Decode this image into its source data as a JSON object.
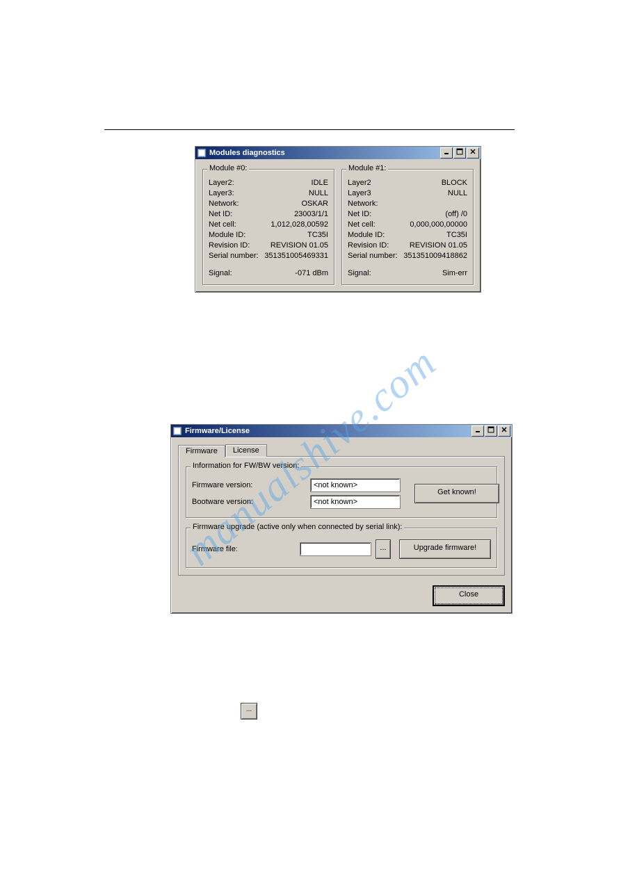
{
  "watermark": "manualshive.com",
  "diag_window": {
    "title": "Modules diagnostics",
    "module0": {
      "legend": "Module #0:",
      "rows": [
        {
          "k": "Layer2:",
          "v": "IDLE"
        },
        {
          "k": "Layer3:",
          "v": "NULL"
        },
        {
          "k": "Network:",
          "v": "OSKAR"
        },
        {
          "k": "Net ID:",
          "v": "23003/1/1"
        },
        {
          "k": "Net cell:",
          "v": "1,012,028,00592"
        },
        {
          "k": "Module ID:",
          "v": "TC35I"
        },
        {
          "k": "Revision ID:",
          "v": "REVISION 01.05"
        },
        {
          "k": "Serial number:",
          "v": "351351005469331"
        }
      ],
      "signal_k": "Signal:",
      "signal_v": "-071 dBm"
    },
    "module1": {
      "legend": "Module #1:",
      "rows": [
        {
          "k": "Layer2",
          "v": "BLOCK"
        },
        {
          "k": "Layer3",
          "v": "NULL"
        },
        {
          "k": "Network:",
          "v": ""
        },
        {
          "k": "Net ID:",
          "v": "(off)  /0"
        },
        {
          "k": "Net cell:",
          "v": "0,000,000,00000"
        },
        {
          "k": "Module ID:",
          "v": "TC35I"
        },
        {
          "k": "Revision ID:",
          "v": "REVISION 01.05"
        },
        {
          "k": "Serial number:",
          "v": "351351009418862"
        }
      ],
      "signal_k": "Signal:",
      "signal_v": "Sim-err"
    }
  },
  "fw_window": {
    "title": "Firmware/License",
    "tabs": {
      "firmware": "Firmware",
      "license": "License"
    },
    "info_group": {
      "legend": "Information for FW/BW version:",
      "fw_label": "Firmware version:",
      "fw_value": "<not known>",
      "bw_label": "Bootware version:",
      "bw_value": "<not known>",
      "btn": "Get known!"
    },
    "upgrade_group": {
      "legend": "Firmware upgrade (active only when connected by serial link):",
      "file_label": "Firmware file:",
      "file_value": "",
      "browse": "...",
      "btn": "Upgrade firmware!"
    },
    "close": "Close"
  },
  "standalone_browse": "..."
}
